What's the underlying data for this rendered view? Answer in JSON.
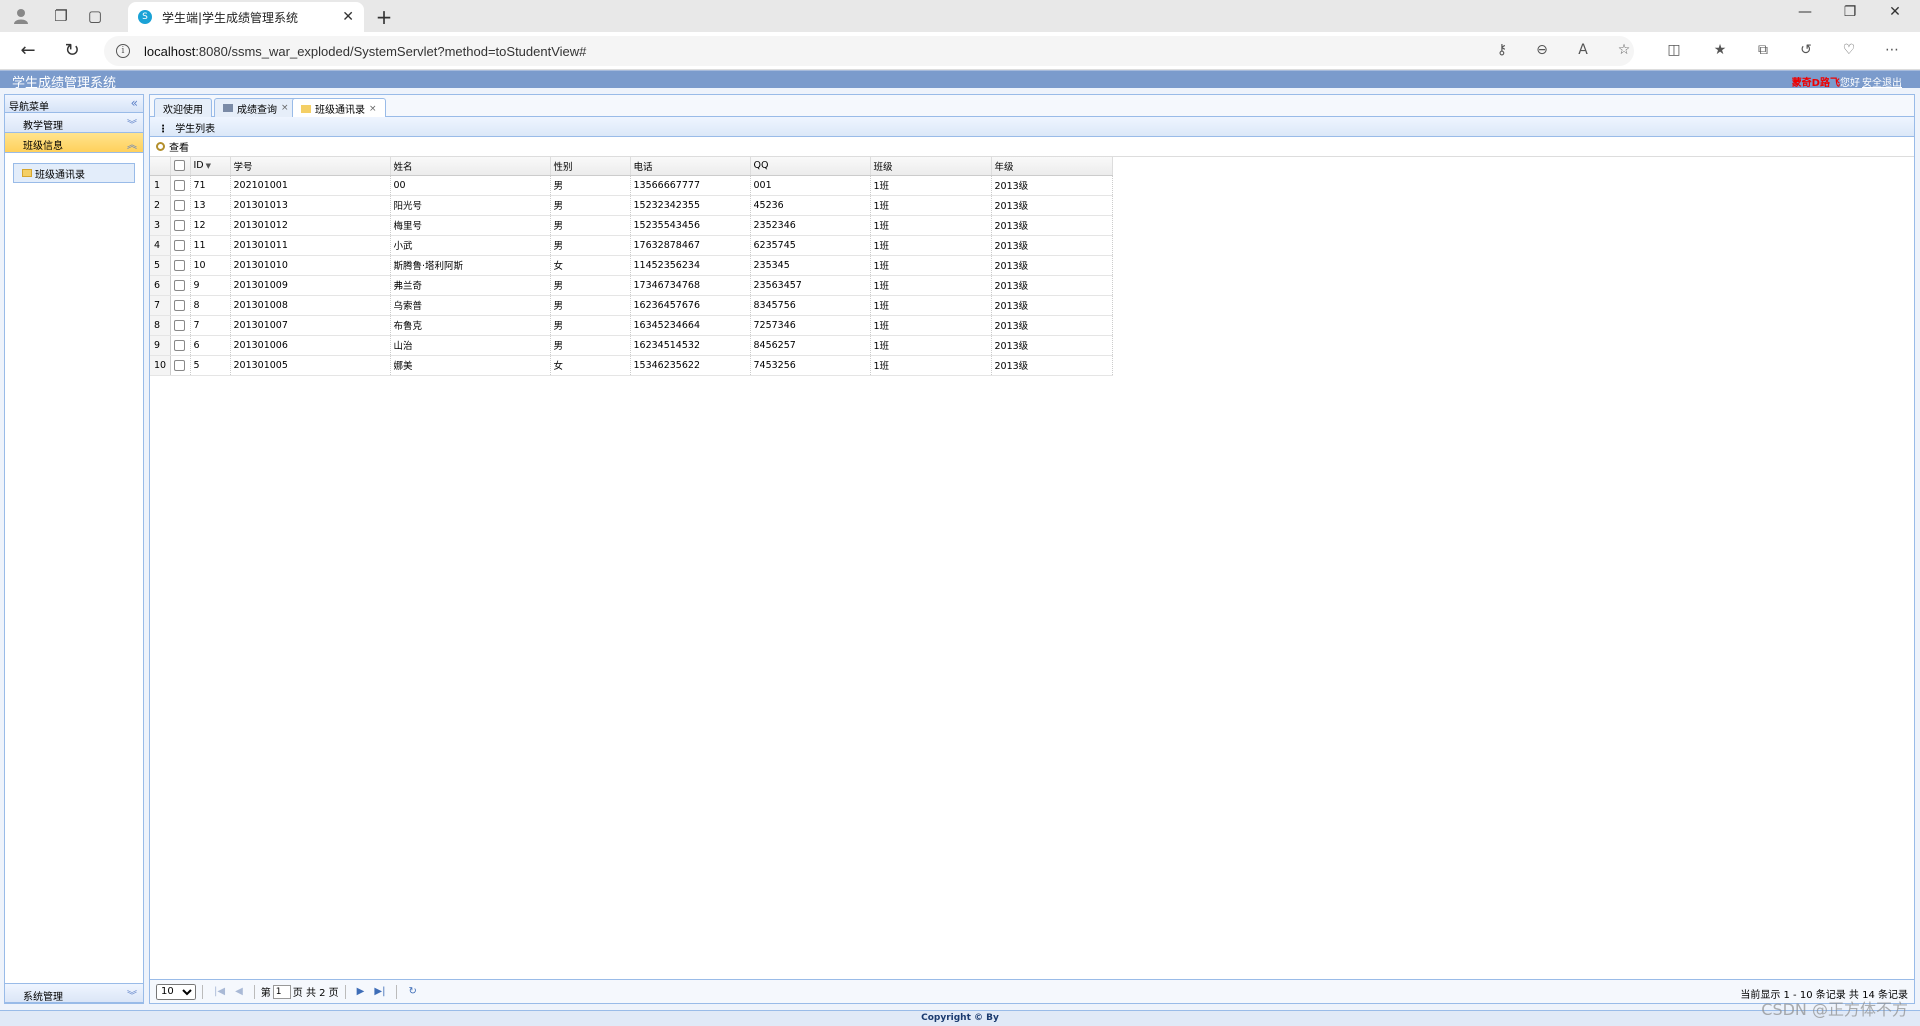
{
  "browser": {
    "tab_title": "学生端|学生成绩管理系统",
    "tab_favicon": "S",
    "url_host": "localhost",
    "url_rest": ":8080/ssms_war_exploded/SystemServlet?method=toStudentView#"
  },
  "app": {
    "title": "学生成绩管理系统",
    "user_name": "蒙奇D路飞",
    "greeting": "您好",
    "logout": "安全退出",
    "footer": "Copyright © By"
  },
  "west": {
    "title": "导航菜单",
    "menus": [
      {
        "label": "教学管理",
        "state": "collapsed"
      },
      {
        "label": "班级信息",
        "state": "expanded"
      },
      {
        "label": "系统管理",
        "state": "collapsed"
      }
    ],
    "tree_item": "班级通讯录"
  },
  "tabs": [
    {
      "label": "欢迎使用",
      "closable": false
    },
    {
      "label": "成绩查询",
      "closable": true
    },
    {
      "label": "班级通讯录",
      "closable": true,
      "active": true
    }
  ],
  "grid": {
    "title": "学生列表",
    "toolbar_view": "查看",
    "columns": [
      "ID",
      "学号",
      "姓名",
      "性别",
      "电话",
      "QQ",
      "班级",
      "年级"
    ],
    "rows": [
      [
        "1",
        "71",
        "202101001",
        "00",
        "男",
        "13566667777",
        "001",
        "1班",
        "2013级"
      ],
      [
        "2",
        "13",
        "201301013",
        "阳光号",
        "男",
        "15232342355",
        "45236",
        "1班",
        "2013级"
      ],
      [
        "3",
        "12",
        "201301012",
        "梅里号",
        "男",
        "15235543456",
        "2352346",
        "1班",
        "2013级"
      ],
      [
        "4",
        "11",
        "201301011",
        "小武",
        "男",
        "17632878467",
        "6235745",
        "1班",
        "2013级"
      ],
      [
        "5",
        "10",
        "201301010",
        "斯腾鲁·塔利阿斯",
        "女",
        "11452356234",
        "235345",
        "1班",
        "2013级"
      ],
      [
        "6",
        "9",
        "201301009",
        "弗兰奇",
        "男",
        "17346734768",
        "23563457",
        "1班",
        "2013级"
      ],
      [
        "7",
        "8",
        "201301008",
        "乌索普",
        "男",
        "16236457676",
        "8345756",
        "1班",
        "2013级"
      ],
      [
        "8",
        "7",
        "201301007",
        "布鲁克",
        "男",
        "16345234664",
        "7257346",
        "1班",
        "2013级"
      ],
      [
        "9",
        "6",
        "201301006",
        "山治",
        "男",
        "16234514532",
        "8456257",
        "1班",
        "2013级"
      ],
      [
        "10",
        "5",
        "201301005",
        "娜美",
        "女",
        "15346235622",
        "7453256",
        "1班",
        "2013级"
      ]
    ]
  },
  "pager": {
    "page_size": "10",
    "page_prefix": "第",
    "page_value": "1",
    "page_suffix": "页 共 2 页",
    "info": "当前显示 1 - 10 条记录 共 14 条记录"
  },
  "watermark": "CSDN @正方体不方",
  "colors": {
    "header": "#7b9bcc",
    "selected_menu": "#ffd15c",
    "border": "#99bbe8"
  }
}
